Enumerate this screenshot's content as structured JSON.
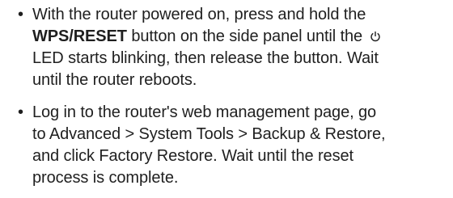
{
  "instructions": [
    {
      "lines": [
        [
          "With the router powered on, press and hold the"
        ],
        [
          "WPS/RESET",
          " button on the side panel until the "
        ],
        [
          "LED starts blinking, then release the button. Wait"
        ],
        [
          "until the router reboots."
        ]
      ],
      "icon": "power-icon"
    },
    {
      "lines": [
        [
          "Log in to the router's web management page, go"
        ],
        [
          "to ",
          "Advanced",
          " > ",
          "System Tools",
          " > ",
          "Backup & Restore",
          ","
        ],
        [
          "and click ",
          "Factory Restore",
          ". Wait until the reset"
        ],
        [
          "process is complete."
        ]
      ]
    }
  ]
}
